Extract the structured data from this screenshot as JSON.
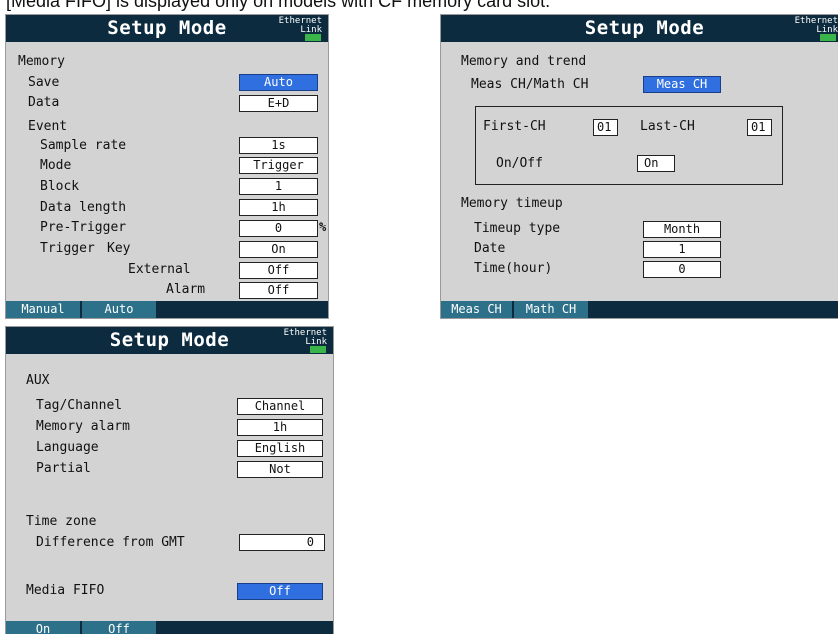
{
  "caption": "[Media FIFO] is displayed only on models with CF memory card slot.",
  "status": {
    "ethernet": "Ethernet",
    "link": "Link"
  },
  "panel1": {
    "title": "Setup Mode",
    "memory": "Memory",
    "save_label": "Save",
    "save_value": "Auto",
    "data_label": "Data",
    "data_value": "E+D",
    "event": "Event",
    "sample_rate_label": "Sample rate",
    "sample_rate_value": "1s",
    "mode_label": "Mode",
    "mode_value": "Trigger",
    "block_label": "Block",
    "block_value": "1",
    "data_length_label": "Data length",
    "data_length_value": "1h",
    "pre_trigger_label": "Pre-Trigger",
    "pre_trigger_value": "0",
    "pre_trigger_unit": "%",
    "trigger_label": "Trigger",
    "key_label": "Key",
    "key_value": "On",
    "external_label": "External",
    "external_value": "Off",
    "alarm_label": "Alarm",
    "alarm_value": "Off",
    "softkeys": [
      "Manual",
      "Auto"
    ]
  },
  "panel2": {
    "title": "Setup Mode",
    "memory_trend": "Memory and trend",
    "meas_math_label": "Meas CH/Math CH",
    "meas_math_value": "Meas CH",
    "first_ch_label": "First-CH",
    "first_ch_value": "01",
    "last_ch_label": "Last-CH",
    "last_ch_value": "01",
    "onoff_label": "On/Off",
    "onoff_value": "On",
    "timeup": "Memory timeup",
    "timeup_type_label": "Timeup type",
    "timeup_type_value": "Month",
    "date_label": "Date",
    "date_value": "1",
    "time_label": "Time(hour)",
    "time_value": "0",
    "softkeys": [
      "Meas CH",
      "Math CH"
    ]
  },
  "panel3": {
    "title": "Setup Mode",
    "aux": "AUX",
    "tag_label": "Tag/Channel",
    "tag_value": "Channel",
    "memalarm_label": "Memory alarm",
    "memalarm_value": "1h",
    "language_label": "Language",
    "language_value": "English",
    "partial_label": "Partial",
    "partial_value": "Not",
    "timezone": "Time zone",
    "gmt_label": "Difference from GMT",
    "gmt_value": "0",
    "fifo_label": "Media FIFO",
    "fifo_value": "Off",
    "softkeys": [
      "On",
      "Off"
    ]
  },
  "colors": {
    "titlebar": "#0c2b3f",
    "screen_bg": "#d3d3d3",
    "selected": "#2f6fe0",
    "softkey": "#2d7089",
    "led": "#3bb54a"
  }
}
